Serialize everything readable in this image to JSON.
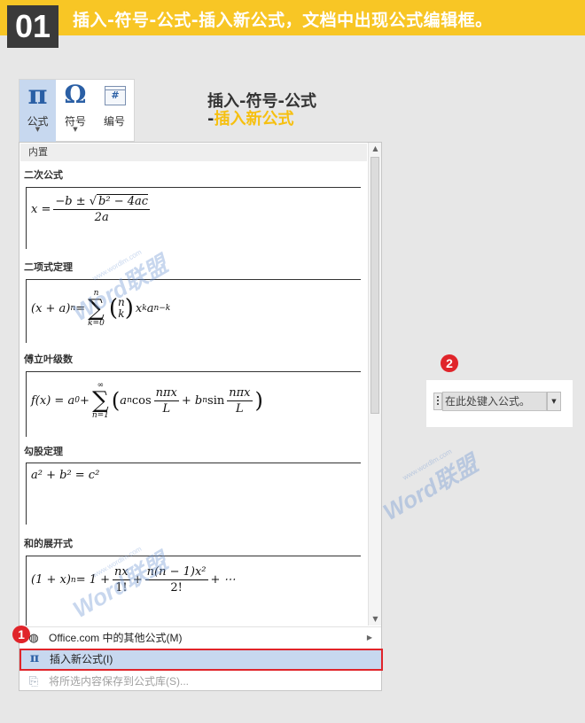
{
  "banner": {
    "step_number": "01",
    "text": "插入-符号-公式-插入新公式，文档中出现公式编辑框。"
  },
  "ribbon": {
    "equation": {
      "icon": "pi-icon",
      "glyph": "π",
      "label": "公式",
      "caret": "▼"
    },
    "symbol": {
      "icon": "omega-icon",
      "glyph": "Ω",
      "label": "符号",
      "caret": "▼"
    },
    "numbering": {
      "icon": "number-icon",
      "glyph": "#",
      "label": "编号"
    }
  },
  "caption": {
    "line1": "插入-符号-公式",
    "line2_dash": "-",
    "line2_text": "插入新公式"
  },
  "gallery": {
    "header": "内置",
    "sections": [
      {
        "title": "二次公式"
      },
      {
        "title": "二项式定理"
      },
      {
        "title": "傅立叶级数"
      },
      {
        "title": "勾股定理"
      },
      {
        "title": "和的展开式"
      }
    ],
    "eq_quadratic": {
      "lhs": "x =",
      "num": "−b ± ",
      "sqrt": "b² − 4ac",
      "den": "2a"
    },
    "eq_binomial": {
      "lhs": "(x + a)",
      "exp_n": "n",
      "eq": " =",
      "sum_top": "n",
      "sum_sym": "∑",
      "sum_bottom": "k=0",
      "binom_top": "n",
      "binom_bottom": "k",
      "x": "x",
      "k": "k",
      "a": "a",
      "nk": "n−k"
    },
    "eq_fourier": {
      "lhs": "f(x) = a",
      "a0": "0",
      "plus": " +",
      "sum_top": "∞",
      "sum_sym": "∑",
      "sum_bottom": "n=1",
      "an": "a",
      "n": "n",
      "cos": " cos",
      "num": "nπx",
      "den": "L",
      "bn_plus": " + b",
      "sin": " sin"
    },
    "eq_pythagorean": "a² + b² = c²",
    "eq_expansion": {
      "lhs": "(1 + x)",
      "n": "n",
      "eq": " = 1 +",
      "f1_num": "nx",
      "f1_den": "1!",
      "plus": " +",
      "f2_num": "n(n − 1)x²",
      "f2_den": "2!",
      "tail": " + ⋯"
    }
  },
  "menu": {
    "office_more": {
      "icon": "globe-icon",
      "label": "Office.com 中的其他公式(M)",
      "arrow": "▶"
    },
    "insert_new": {
      "icon": "pi-icon",
      "glyph": "π",
      "label": "插入新公式(I)"
    },
    "save_selection": {
      "icon": "save-gallery-icon",
      "label": "将所选内容保存到公式库(S)..."
    }
  },
  "steps": {
    "one": "1",
    "two": "2"
  },
  "editor": {
    "placeholder": "在此处键入公式。",
    "drop": "▼"
  },
  "watermark": {
    "brand": "Word联盟",
    "url": "www.wordlm.com"
  },
  "scrollbar": {
    "up": "▲",
    "down": "▼"
  },
  "colors": {
    "banner": "#f8c625",
    "accent_yellow": "#f6c010",
    "highlight": "#c7d8ef",
    "red": "#e0242a",
    "blue": "#2a5fa5"
  }
}
